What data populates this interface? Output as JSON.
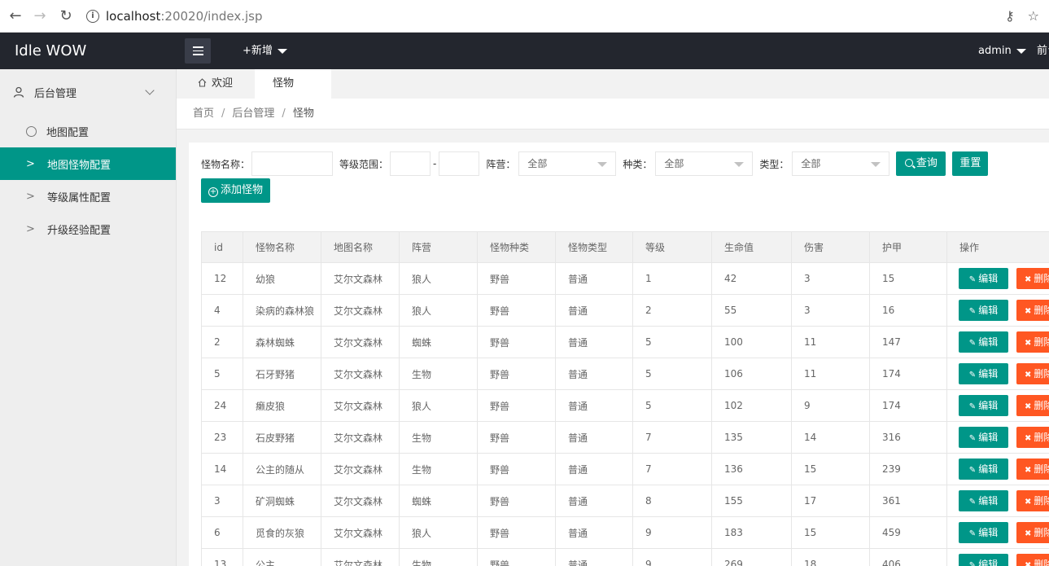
{
  "browser": {
    "url_host": "localhost",
    "url_rest": ":20020/index.jsp"
  },
  "header": {
    "app_title": "Idle WOW",
    "add_new": "+新增",
    "user": "admin",
    "front_link": "前台"
  },
  "sidebar": {
    "parent": "后台管理",
    "items": [
      {
        "label": "地图配置"
      },
      {
        "label": "地图怪物配置"
      },
      {
        "label": "等级属性配置"
      },
      {
        "label": "升级经验配置"
      }
    ]
  },
  "tabs": [
    {
      "label": "欢迎"
    },
    {
      "label": "怪物"
    }
  ],
  "breadcrumb": [
    "首页",
    "后台管理",
    "怪物"
  ],
  "search": {
    "name_label": "怪物名称：",
    "level_label": "等级范围：",
    "level_sep": "-",
    "faction_label": "阵营：",
    "faction_value": "全部",
    "species_label": "种类：",
    "species_value": "全部",
    "type_label": "类型：",
    "type_value": "全部",
    "query_button": "查询",
    "reset_button": "重置",
    "add_button": "添加怪物"
  },
  "table": {
    "columns": [
      "id",
      "怪物名称",
      "地图名称",
      "阵营",
      "怪物种类",
      "怪物类型",
      "等级",
      "生命值",
      "伤害",
      "护甲",
      "操作"
    ],
    "edit_label": "编辑",
    "delete_label": "删除",
    "rows": [
      [
        "12",
        "幼狼",
        "艾尔文森林",
        "狼人",
        "野兽",
        "普通",
        "1",
        "42",
        "3",
        "15"
      ],
      [
        "4",
        "染病的森林狼",
        "艾尔文森林",
        "狼人",
        "野兽",
        "普通",
        "2",
        "55",
        "3",
        "16"
      ],
      [
        "2",
        "森林蜘蛛",
        "艾尔文森林",
        "蜘蛛",
        "野兽",
        "普通",
        "5",
        "100",
        "11",
        "147"
      ],
      [
        "5",
        "石牙野猪",
        "艾尔文森林",
        "生物",
        "野兽",
        "普通",
        "5",
        "106",
        "11",
        "174"
      ],
      [
        "24",
        "癞皮狼",
        "艾尔文森林",
        "狼人",
        "野兽",
        "普通",
        "5",
        "102",
        "9",
        "174"
      ],
      [
        "23",
        "石皮野猪",
        "艾尔文森林",
        "生物",
        "野兽",
        "普通",
        "7",
        "135",
        "14",
        "316"
      ],
      [
        "14",
        "公主的随从",
        "艾尔文森林",
        "生物",
        "野兽",
        "普通",
        "7",
        "136",
        "15",
        "239"
      ],
      [
        "3",
        "矿洞蜘蛛",
        "艾尔文森林",
        "蜘蛛",
        "野兽",
        "普通",
        "8",
        "155",
        "17",
        "361"
      ],
      [
        "6",
        "觅食的灰狼",
        "艾尔文森林",
        "狼人",
        "野兽",
        "普通",
        "9",
        "183",
        "15",
        "459"
      ],
      [
        "13",
        "公主",
        "艾尔文森林",
        "生物",
        "野兽",
        "普通",
        "9",
        "269",
        "18",
        "406"
      ]
    ]
  },
  "colors": {
    "accent": "#009688",
    "danger": "#ff5722",
    "header_bg": "#23262e"
  }
}
